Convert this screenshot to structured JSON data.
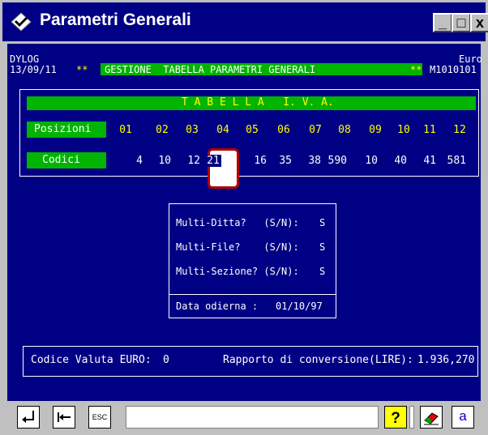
{
  "window": {
    "title": "Parametri Generali",
    "buttons": {
      "minimize": "_",
      "maximize": "□",
      "close": "x"
    }
  },
  "header": {
    "company": "DYLOG",
    "date": "13/09/11",
    "stars_left": "**",
    "program_title": "GESTIONE  TABELLA PARAMETRI GENERALI",
    "stars_right": "**",
    "currency": "Euro",
    "program_code": "M1010101"
  },
  "iva_table": {
    "title": "T A B E L L A   I. V. A.",
    "positions_label": "Posizioni",
    "codes_label": "Codici",
    "positions": [
      "01",
      "02",
      "03",
      "04",
      "05",
      "06",
      "07",
      "08",
      "09",
      "10",
      "11",
      "12"
    ],
    "codes": [
      "4",
      "10",
      "12",
      "21",
      "16",
      "35",
      "38",
      "590",
      "10",
      "40",
      "41",
      "581"
    ]
  },
  "options": {
    "multi_ditta": {
      "label": "Multi-Ditta?   (S/N):",
      "value": "S"
    },
    "multi_file": {
      "label": "Multi-File?    (S/N):",
      "value": "S"
    },
    "multi_sezione": {
      "label": "Multi-Sezione? (S/N):",
      "value": "S"
    },
    "data_odierna": {
      "label": "Data odierna :",
      "value": "01/10/97"
    }
  },
  "footer": {
    "codice_valuta_label": "Codice Valuta EURO:",
    "codice_valuta_value": "0",
    "rapporto_label": "Rapporto di conversione(LIRE):",
    "rapporto_value": "1.936,270"
  },
  "statusbar": {
    "enter_icon": "enter-key-icon",
    "tab_icon": "tab-back-icon",
    "esc_label": "ESC",
    "help_icon": "help-question-icon",
    "eraser_icon": "eraser-icon",
    "font_label": "a"
  }
}
